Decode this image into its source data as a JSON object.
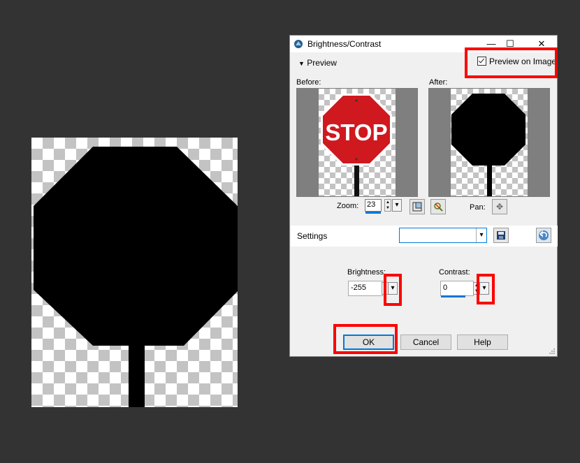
{
  "dialog": {
    "title": "Brightness/Contrast",
    "window_controls": {
      "minimize": "—",
      "maximize": "☐",
      "close": "✕"
    },
    "preview_toggle_label": "Preview",
    "preview_on_image_label": "Preview on Image",
    "preview_on_image_checked": true,
    "before_label": "Before:",
    "after_label": "After:",
    "stop_sign_text": "STOP",
    "zoom_label": "Zoom:",
    "zoom_value": "23",
    "pan_label": "Pan:",
    "settings_label": "Settings",
    "settings_value": "",
    "brightness_label": "Brightness:",
    "brightness_value": "-255",
    "contrast_label": "Contrast:",
    "contrast_value": "0",
    "ok_label": "OK",
    "cancel_label": "Cancel",
    "help_label": "Help"
  },
  "icons": {
    "dropdown": "▾",
    "spin_up": "▲",
    "spin_down": "▼",
    "pan": "✥",
    "preview_triangle": "▼"
  },
  "colors": {
    "accent": "#0078d7",
    "highlight": "#ff0000",
    "stop_red": "#d0181f",
    "background": "#333333"
  }
}
